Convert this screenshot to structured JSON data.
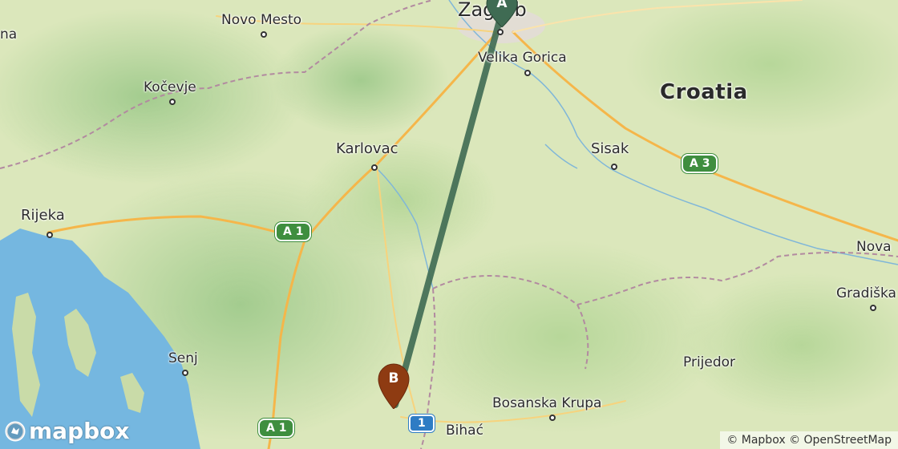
{
  "map": {
    "country_label": "Croatia",
    "places": [
      {
        "name": "Zagreb"
      },
      {
        "name": "Velika Gorica"
      },
      {
        "name": "Novo Mesto"
      },
      {
        "name": "Kočevje"
      },
      {
        "name": "Karlovac"
      },
      {
        "name": "Sisak"
      },
      {
        "name": "Rijeka"
      },
      {
        "name": "Senj"
      },
      {
        "name": "Prijedor"
      },
      {
        "name": "Bosanska Krupa"
      },
      {
        "name": "Bihać"
      },
      {
        "name": "Nova"
      },
      {
        "name": "Gradiška"
      },
      {
        "name": "na"
      }
    ],
    "road_shields": [
      {
        "label": "A 3"
      },
      {
        "label": "A 1"
      },
      {
        "label": "A 1"
      },
      {
        "label": "1"
      }
    ],
    "route": {
      "color": "#3f6b53",
      "start": {
        "letter": "A",
        "color": "#3f6b53"
      },
      "end": {
        "letter": "B",
        "color": "#8e3b12"
      }
    },
    "logo": "mapbox",
    "attribution": "© Mapbox © OpenStreetMap"
  }
}
